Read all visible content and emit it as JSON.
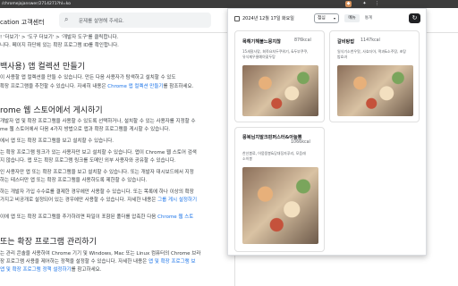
{
  "browser": {
    "url": "/chromejajanswer/2714271?hl=ko"
  },
  "site": {
    "name": "cation 고객센터",
    "search_placeholder": "문제를 설명해 주세요."
  },
  "article": {
    "lines_top": [
      "! '더보기' > '도구 더보기' > '개발자 도구'를 클릭합니다.",
      "니다. 페이지 하단에 있는 확장 프로그램 ID를 확인합니다."
    ],
    "h1": "백사용) 앱 컬렉션 만들기",
    "para1": [
      "이 사용할 앱 컬렉션을 만들 수 있습니다. 만든 다음 사용자가 탐색하고 설치할 수 있도",
      "확장 프로그램을 추천할 수 있습니다. 자세히 내용은"
    ],
    "para1_link": "Chrome 앱 컬렉션 만들기",
    "para1_tail": "를 참조하세요.",
    "h2": "rome 웹 스토어에서 게시하기",
    "para2": [
      "개발자 앱 및 확장 프로그램을 사용할 수 있도록 선택하거나, 설치할 수 있는 사용자를 지정할 수",
      "me 웹 스토어에서 다음 4가지 방법으로 앱과 확장 프로그램을 게시할 수 있습니다.",
      "에서 앱 또는 확장 프로그램을 보고 설치할 수 있습니다.",
      "는 확장 프로그램 링크가 있는 사용자만 보고 설치할 수 있습니다. 앱이 Chrome 웹 스토어 검색",
      "지 않습니다. 앱 또는 확장 프로그램 링크를 도메인 외부 사용자와 공유할 수 있습니다.",
      "인 사용자만 앱 또는 확장 프로그램을 보고 설치할 수 있습니다. 또는 개발자 대시보드에서 지정",
      "하는 테스터만 앱 또는 확장 프로그램을 사용하도록 제한할 수 있습니다.",
      "하는 개발자 가입 수수료를 결제한 경우에만 사용할 수 있습니다. 또는 목록에 하나 이상의 확장",
      "가지고 비공개로 설정되어 있는 경우에만 사용할 수 있습니다. 자세한 내용은"
    ],
    "para2_link": "그룹 게시 설정하기",
    "para3": "이에 앱 또는 확장 프로그램을 추가하려면 파일이 포함된 폴더를 압축한 다음",
    "para3_link": "Chrome 웹 스토",
    "h3": "또는 확장 프로그램 관리하기",
    "para4": [
      "는 관리 콘솔을 사용하여 Chrome 기기 및 Windows, Mac 또는 Linux 컴퓨터의 Chrome 브라",
      "장 프로그램 사용을 제어하는 정책을 설정할 수 있습니다. 자세한 내용은"
    ],
    "para4_link": "앱 및 확장 프로그램 보",
    "para4_tail_link": "앱 및 확장 프로그램 정책 설정하기",
    "para4_tail": "를 참고하세요."
  },
  "popup": {
    "date": "2024년 12월 17일 화요일",
    "select_value": "점심",
    "tabs": [
      "메뉴",
      "통계"
    ],
    "refresh_icon": "refresh-icon",
    "cards": [
      {
        "name": "목해기해불느뭉치찮",
        "kcal": "876kcal",
        "desc": [
          "15새잘사맞, 회쭉요처두쿠워기, &두부쿠쿠,",
          "유식제우물예야꽃두탕"
        ]
      },
      {
        "name": "갈비탕밥",
        "kcal": "1147kcal",
        "desc": [
          "일식기소천우맛, 사효더아, 떡과&소주땅, 초탕",
          "밥효과"
        ]
      },
      {
        "name": "뭉북님치말크핀퍼스터&아늘뽕",
        "kcal": "1066kcal",
        "desc": [
          "찬선봄료, 어뭉뭉봉&당대징자푸리, 모음래",
          "소히봉"
        ]
      }
    ]
  }
}
